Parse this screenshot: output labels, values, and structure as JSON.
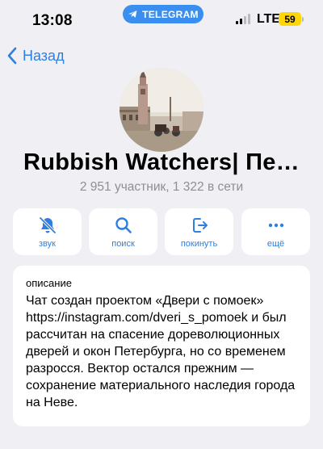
{
  "status_bar": {
    "time": "13:08",
    "telegram_pill": "TELEGRAM",
    "network": "LTE",
    "battery": "59",
    "battery_color": "#ffd60a"
  },
  "nav": {
    "back_label": "Назад"
  },
  "chat": {
    "title": "Rubbish Watchers| Пе…",
    "subtitle": "2 951 участник, 1 322 в сети"
  },
  "actions": [
    {
      "label": "звук",
      "icon": "bell-muted-icon"
    },
    {
      "label": "поиск",
      "icon": "search-icon"
    },
    {
      "label": "покинуть",
      "icon": "leave-icon"
    },
    {
      "label": "ещё",
      "icon": "more-icon"
    }
  ],
  "description": {
    "label": "описание",
    "text": "Чат создан проектом «Двери с помоек» https://instagram.com/dveri_s_pomoek и был рассчитан на спасение дореволюционных дверей и окон Петербурга, но со временем разросся. Вектор остался прежним — сохранение материального наследия города на Неве."
  },
  "colors": {
    "accent": "#2f7fe0",
    "background": "#efeff4",
    "subtitle": "#8e8e93"
  }
}
